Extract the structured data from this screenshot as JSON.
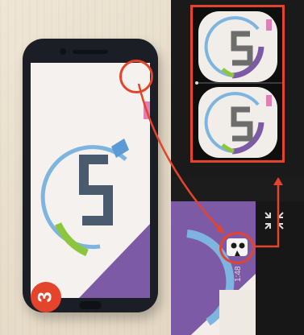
{
  "step_badge": "3",
  "status_clock": "1:48",
  "icons": {
    "exit_fullscreen": "exit-fullscreen-icon",
    "cardboard_vr": "cardboard-vr-icon"
  },
  "colors": {
    "highlight": "#e4442b",
    "logo_blue": "#7eb4e0",
    "logo_green": "#8cc63f",
    "logo_purple": "#7d5aa6",
    "logo_pink": "#e07fb7",
    "logo_gray": "#4a5b6e"
  }
}
